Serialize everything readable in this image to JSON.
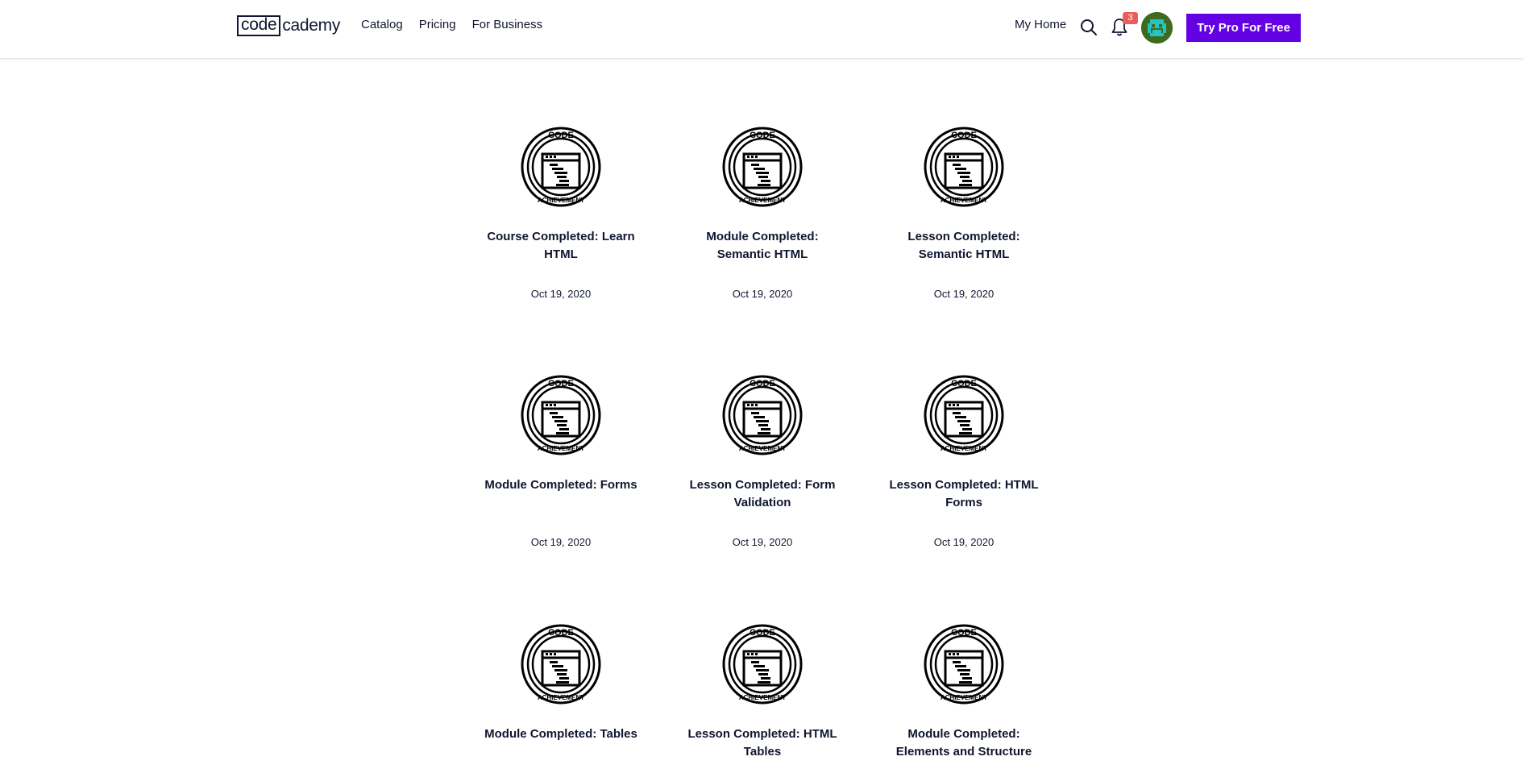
{
  "nav": {
    "logo_box": "code",
    "logo_rest": "cademy",
    "links": [
      "Catalog",
      "Pricing",
      "For Business"
    ],
    "my_home": "My Home",
    "notification_count": "3",
    "cta": "Try Pro For Free",
    "search_icon": "search-icon",
    "bell_icon": "bell-icon"
  },
  "badge_text": {
    "top": "CODE",
    "bottom": "ACHIEVEMENT"
  },
  "achievements": [
    {
      "title": "Course Completed: Learn HTML",
      "date": "Oct 19, 2020"
    },
    {
      "title": "Module Completed: Semantic HTML",
      "date": "Oct 19, 2020"
    },
    {
      "title": "Lesson Completed: Semantic HTML",
      "date": "Oct 19, 2020"
    },
    {
      "title": "Module Completed: Forms",
      "date": "Oct 19, 2020"
    },
    {
      "title": "Lesson Completed: Form Validation",
      "date": "Oct 19, 2020"
    },
    {
      "title": "Lesson Completed: HTML Forms",
      "date": "Oct 19, 2020"
    },
    {
      "title": "Module Completed: Tables",
      "date": ""
    },
    {
      "title": "Lesson Completed: HTML Tables",
      "date": ""
    },
    {
      "title": "Module Completed: Elements and Structure",
      "date": ""
    }
  ],
  "colors": {
    "brand": "#6400e4",
    "text": "#10162f",
    "badge_red": "#e85d5d"
  }
}
